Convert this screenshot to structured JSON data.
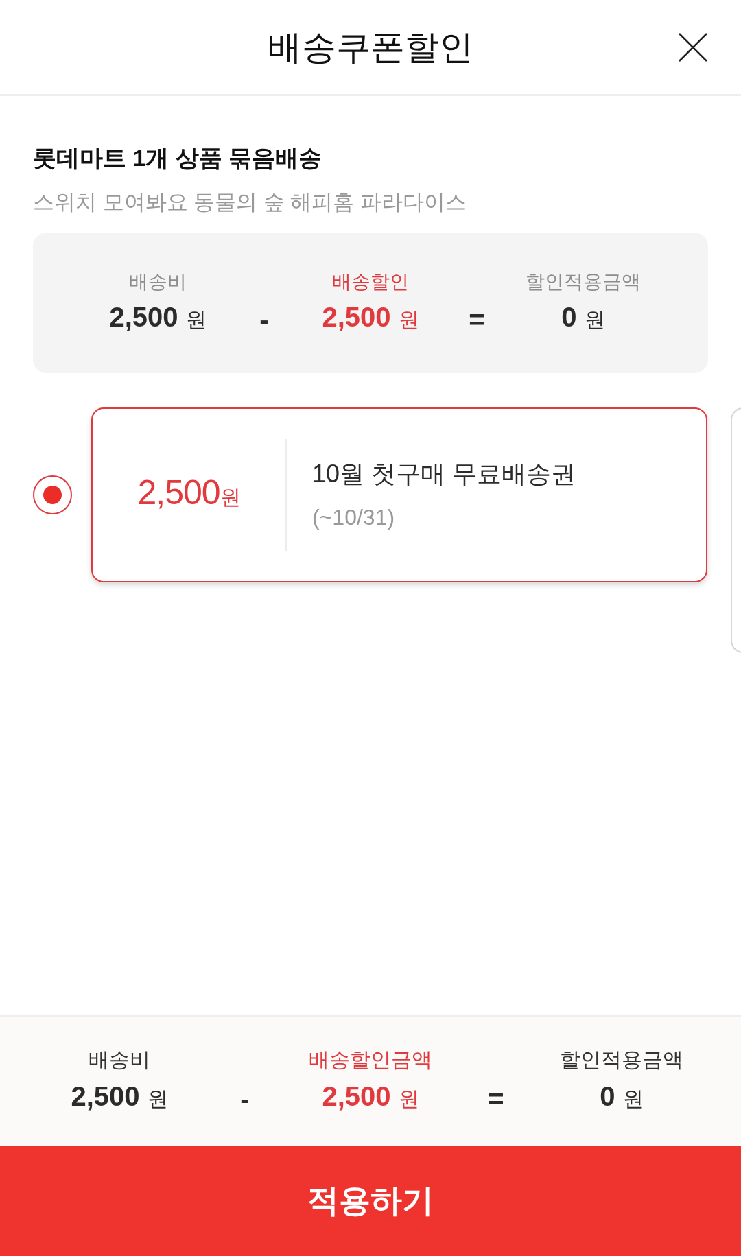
{
  "header": {
    "title": "배송쿠폰할인"
  },
  "bundle": {
    "title": "롯데마트 1개 상품 묶음배송",
    "product": "스위치 모여봐요 동물의 숲 해피홈 파라다이스"
  },
  "summary": [
    {
      "kind": "amount",
      "label": "배송비",
      "value": "2,500",
      "unit": "원",
      "highlighted": false
    },
    {
      "kind": "operator",
      "symbol": "-"
    },
    {
      "kind": "amount",
      "label": "배송할인",
      "value": "2,500",
      "unit": "원",
      "highlighted": true
    },
    {
      "kind": "operator",
      "symbol": "="
    },
    {
      "kind": "amount",
      "label": "할인적용금액",
      "value": "0",
      "unit": "원",
      "highlighted": false
    }
  ],
  "coupons": [
    {
      "selected": true,
      "amount": "2,500",
      "unit": "원",
      "name": "10월 첫구매 무료배송권",
      "period": "(~10/31)"
    }
  ],
  "totals": [
    {
      "kind": "amount",
      "label": "배송비",
      "value": "2,500",
      "unit": "원",
      "highlighted": false
    },
    {
      "kind": "operator",
      "symbol": "-"
    },
    {
      "kind": "amount",
      "label": "배송할인금액",
      "value": "2,500",
      "unit": "원",
      "highlighted": true
    },
    {
      "kind": "operator",
      "symbol": "="
    },
    {
      "kind": "amount",
      "label": "할인적용금액",
      "value": "0",
      "unit": "원",
      "highlighted": false
    }
  ],
  "apply_button": {
    "label": "적용하기"
  }
}
